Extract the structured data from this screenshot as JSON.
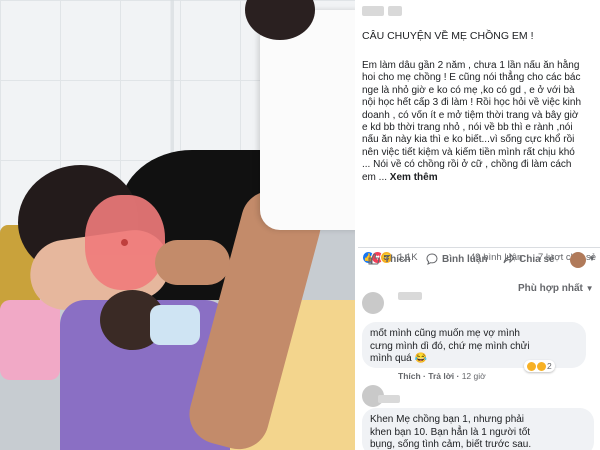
{
  "post": {
    "title": "CÂU CHUYỆN VỀ MẸ CHỒNG EM !",
    "body": "Em làm dâu gần 2 năm , chưa 1 lần nấu ăn hằng\nhoi cho mẹ chồng ! E cũng nói thẳng cho các bác\nnge là nhỏ giờ e ko có mẹ ,ko có gd , e ở với bà\nnội học hết cấp 3 đi làm ! Rồi học hỏi về việc kinh\ndoanh , có vốn ít e mở tiệm thời trang và bây giờ\ne kd bb thời trang nhỏ , nói về bb thì e rành ,nói\nnấu ăn này kia thì e ko biết...vì sống cực khổ rồi\nnên việc tiết kiệm và kiếm tiền mình rất chịu khó\n... Nói về có chồng rồi ở cữ , chồng đi làm cách\nem ...",
    "see_more": "Xem thêm"
  },
  "reactions": {
    "count": "1,1K",
    "comments": "49 bình luận",
    "shares": "7 lượt chia sẻ"
  },
  "actions": {
    "like": "Thích",
    "comment": "Bình luận",
    "share": "Chia sẻ"
  },
  "sort": {
    "label": "Phù hợp nhất"
  },
  "comments": [
    {
      "text": "mốt mình cũng muốn mẹ vợ mình\ncưng mình dì đó, chứ mẹ mình chửi\nmình quá 😂",
      "like": "Thích",
      "reply": "Trả lời",
      "time": "12 giờ",
      "react_count": "2"
    },
    {
      "text": "Khen Mẹ chồng bạn 1, nhưng phải\nkhen bạn 10. Bạn hẳn là 1 người tốt\nbụng, sống tình cảm, biết trước sau."
    }
  ],
  "colors": {
    "facebook_blue": "#1877f2",
    "love": "#f33e58",
    "haha": "#f7b125",
    "bubble": "#f0f2f5",
    "muted_text": "#65676b"
  }
}
